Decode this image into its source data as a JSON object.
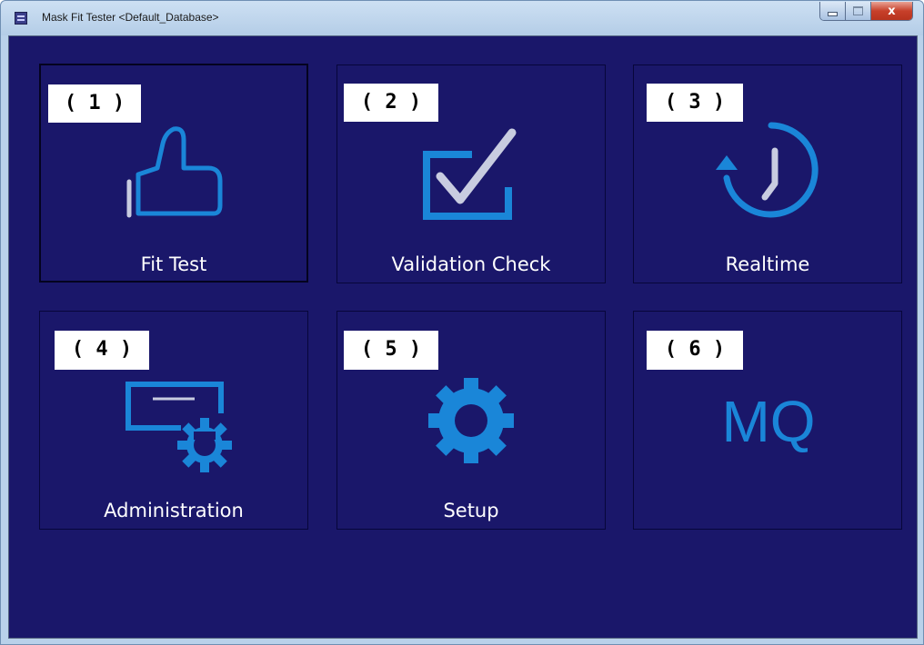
{
  "window": {
    "title": "Mask Fit Tester <Default_Database>",
    "controls": {
      "close_label": "x"
    }
  },
  "colors": {
    "background": "#1a176a",
    "icon_blue": "#1a86d8",
    "icon_light": "#c8cce0",
    "badge_bg": "#ffffff",
    "label_text": "#ffffff"
  },
  "tiles": [
    {
      "badge": "( 1 )",
      "label": "Fit Test",
      "icon": "thumbs-up-icon",
      "selected": true
    },
    {
      "badge": "( 2 )",
      "label": "Validation Check",
      "icon": "checkbox-icon"
    },
    {
      "badge": "( 3 )",
      "label": "Realtime",
      "icon": "clock-refresh-icon"
    },
    {
      "badge": "( 4 )",
      "label": "Administration",
      "icon": "certificate-gear-icon"
    },
    {
      "badge": "( 5 )",
      "label": "Setup",
      "icon": "gear-icon"
    },
    {
      "badge": "( 6 )",
      "label": "",
      "icon": "mq-logo",
      "icon_text": "MQ"
    }
  ]
}
